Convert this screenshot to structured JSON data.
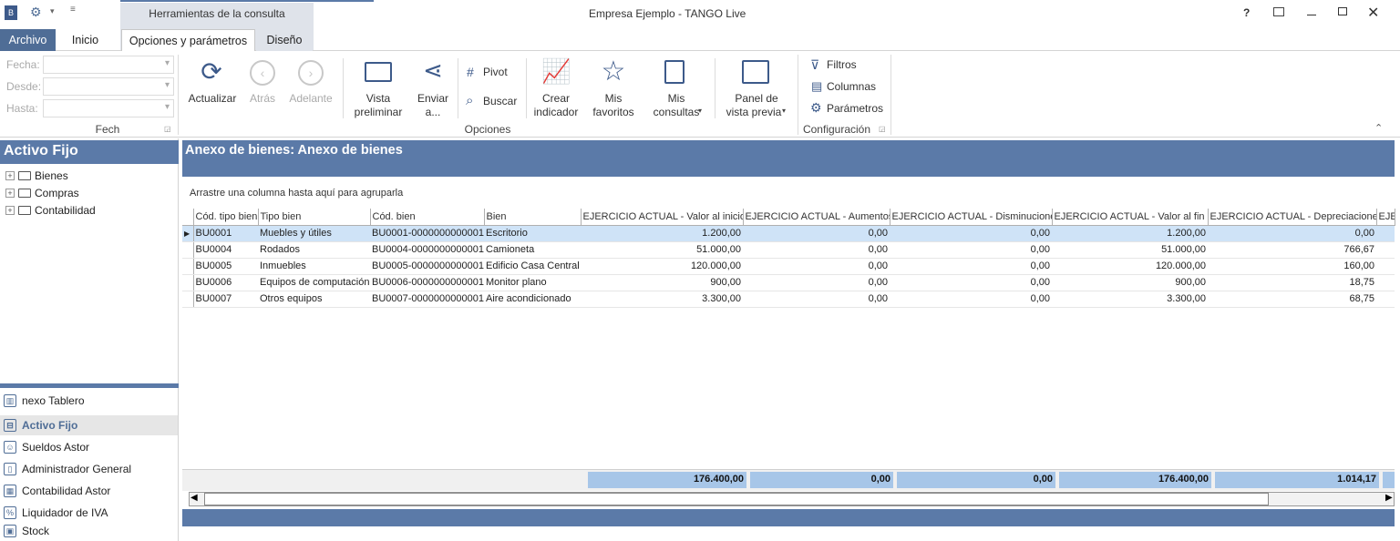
{
  "title_bar": {
    "app_title": "Empresa Ejemplo - TANGO  Live",
    "context_title": "Herramientas de la consulta",
    "help": "?"
  },
  "tabs": [
    "Archivo",
    "Inicio",
    "Opciones y parámetros",
    "Diseño"
  ],
  "filters": {
    "fecha_label": "Fecha:",
    "desde_label": "Desde:",
    "hasta_label": "Hasta:",
    "group_label": "Fech"
  },
  "ribbon": {
    "actualizar": "Actualizar",
    "atras": "Atrás",
    "adelante": "Adelante",
    "vista_1": "Vista",
    "vista_2": "preliminar",
    "enviar_1": "Enviar",
    "enviar_2": "a...",
    "pivot": "Pivot",
    "buscar": "Buscar",
    "crear_1": "Crear",
    "crear_2": "indicador",
    "fav_1": "Mis",
    "fav_2": "favoritos",
    "cons_1": "Mis",
    "cons_2": "consultas",
    "panel_1": "Panel de",
    "panel_2": "vista previa",
    "opciones_group": "Opciones",
    "filtros": "Filtros",
    "columnas": "Columnas",
    "parametros": "Parámetros",
    "config_group": "Configuración"
  },
  "left_panel": {
    "title": "Activo Fijo",
    "tree": [
      "Bienes",
      "Compras",
      "Contabilidad"
    ],
    "nav": [
      "nexo Tablero",
      "Activo Fijo",
      "Sueldos Astor",
      "Administrador General",
      "Contabilidad Astor",
      "Liquidador de IVA",
      "Stock"
    ]
  },
  "main": {
    "title": "Anexo de bienes: Anexo de bienes",
    "group_hint": "Arrastre una columna hasta aquí para agruparla",
    "columns": [
      "Cód. tipo bien",
      "Tipo bien",
      "Cód. bien",
      "Bien",
      "EJERCICIO ACTUAL - Valor al inicio",
      "EJERCICIO ACTUAL - Aumentos",
      "EJERCICIO ACTUAL - Disminuciones",
      "EJERCICIO ACTUAL - Valor al fin",
      "EJERCICIO ACTUAL - Depreciaciones",
      "EJE"
    ],
    "rows": [
      [
        "BU0001",
        "Muebles y útiles",
        "BU0001-0000000000001",
        "Escritorio",
        "1.200,00",
        "0,00",
        "0,00",
        "1.200,00",
        "0,00"
      ],
      [
        "BU0004",
        "Rodados",
        "BU0004-0000000000001",
        "Camioneta",
        "51.000,00",
        "0,00",
        "0,00",
        "51.000,00",
        "766,67"
      ],
      [
        "BU0005",
        "Inmuebles",
        "BU0005-0000000000001",
        "Edificio Casa Central",
        "120.000,00",
        "0,00",
        "0,00",
        "120.000,00",
        "160,00"
      ],
      [
        "BU0006",
        "Equipos de computación",
        "BU0006-0000000000001",
        "Monitor plano",
        "900,00",
        "0,00",
        "0,00",
        "900,00",
        "18,75"
      ],
      [
        "BU0007",
        "Otros equipos",
        "BU0007-0000000000001",
        "Aire acondicionado",
        "3.300,00",
        "0,00",
        "0,00",
        "3.300,00",
        "68,75"
      ]
    ],
    "totals": [
      "176.400,00",
      "0,00",
      "0,00",
      "176.400,00",
      "1.014,17"
    ]
  },
  "colors": {
    "accent": "#5b7aa8",
    "selected_row": "#cfe3f7",
    "totals": "#a7c6e8"
  }
}
